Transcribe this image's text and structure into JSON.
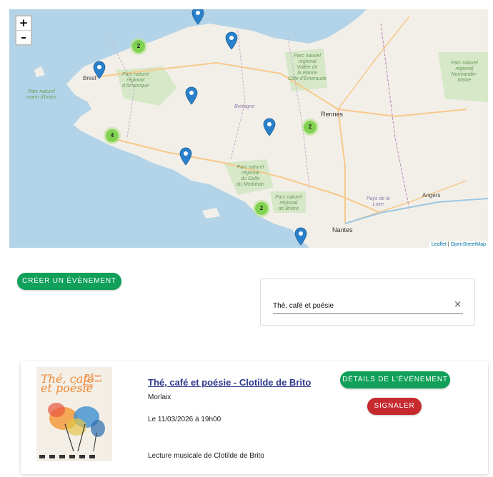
{
  "map": {
    "zoom_in": "+",
    "zoom_out": "–",
    "attribution_leaflet": "Leaflet",
    "attribution_sep": "|",
    "attribution_osm": "OpenStreetMap",
    "labels": {
      "parc_armorique": "Parc naturel\nrégional\nd'Armorique",
      "parc_iroise": "Parc naturel\nmarin d'Iroise",
      "parc_rance": "Parc naturel\nrégional\nVallée de\nla Rance\nCôte d'Émeraude",
      "parc_normandie": "Parc naturel\nrégional\nNormandie-\nMaine",
      "parc_morbihan": "Parc naturel\nrégional\ndu Golfe\ndu Morbihan",
      "parc_briere": "Parc naturel\nrégional\nde Brière",
      "pays_loire": "Pays de la\nLoire",
      "bretagne": "Bretagne"
    },
    "cities": {
      "brest": "Brest",
      "rennes": "Rennes",
      "nantes": "Nantes",
      "angers": "Angers"
    },
    "clusters": [
      {
        "id": "c1",
        "count": "2"
      },
      {
        "id": "c2",
        "count": "4"
      },
      {
        "id": "c3",
        "count": "2"
      },
      {
        "id": "c4",
        "count": "2"
      }
    ],
    "marker_color": "#2a81cb",
    "cluster_color": "#6ecc39"
  },
  "actions": {
    "create_label": "CRÉER UN ÉVÈNEMENT"
  },
  "search": {
    "value": "Thé, café et poésie",
    "clear_icon": "×"
  },
  "event": {
    "title": "Thé, café et poésie - Clotilde de Brito",
    "city": "Morlaix",
    "datetime": "Le 11/03/2026 à 19h00",
    "description": "Lecture musicale de Clotilde de Brito",
    "details_label": "DÉTAILS DE L'ÉVÉNEMENT",
    "report_label": "SIGNALER",
    "poster_title": "Thé, café\net poésie",
    "poster_dates": "Du 9 mars\nau 18 avril\n2026"
  },
  "colors": {
    "primary_green": "#11a05a",
    "danger_red": "#c62a2f",
    "link_blue": "#2e3a8c"
  }
}
